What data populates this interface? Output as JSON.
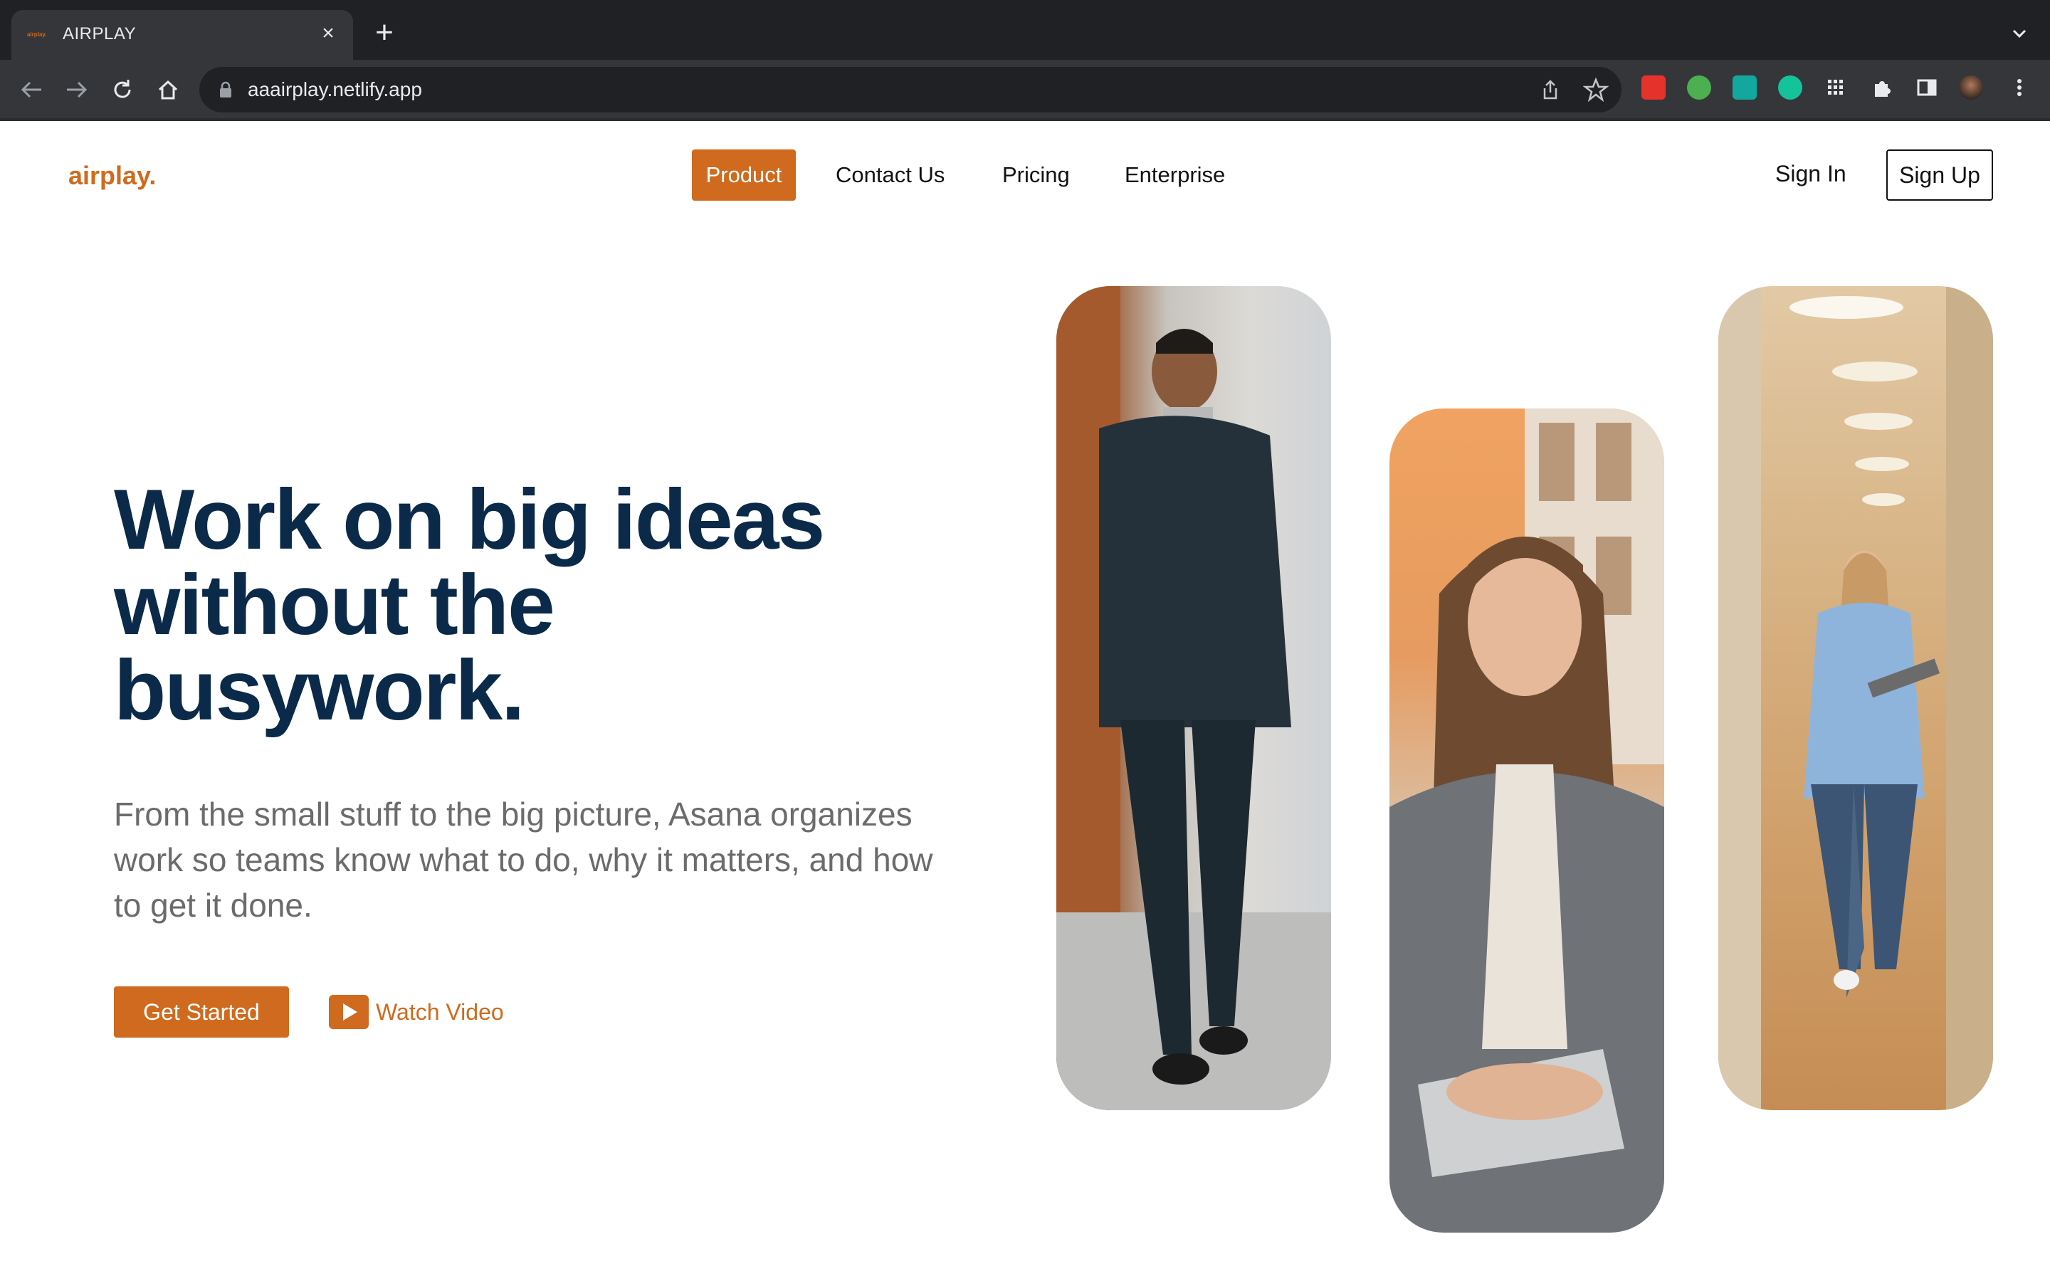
{
  "browser": {
    "tab_title": "AIRPLAY",
    "tab_favicon_text": "airplay.",
    "url": "aaairplay.netlify.app",
    "icons": [
      "back-icon",
      "forward-icon",
      "reload-icon",
      "home-icon",
      "lock-icon",
      "share-icon",
      "star-icon",
      "extensions-icon",
      "sidepanel-icon",
      "profile-avatar",
      "menu-icon"
    ]
  },
  "header": {
    "logo": "airplay.",
    "nav": [
      "Product",
      "Contact Us",
      "Pricing",
      "Enterprise"
    ],
    "sign_in": "Sign In",
    "sign_up": "Sign Up"
  },
  "hero": {
    "headline_line1": "Work on big ideas",
    "headline_line2": "without the",
    "headline_line3": "busywork.",
    "subtext": "From the small stuff to the big picture, Asana organizes work so teams know what to do, why it matters, and how to get it done.",
    "cta_primary": "Get Started",
    "cta_secondary": "Watch Video"
  },
  "colors": {
    "accent": "#cf6a1e",
    "headline": "#0b2a4a",
    "body_text": "#6b6b6b"
  }
}
